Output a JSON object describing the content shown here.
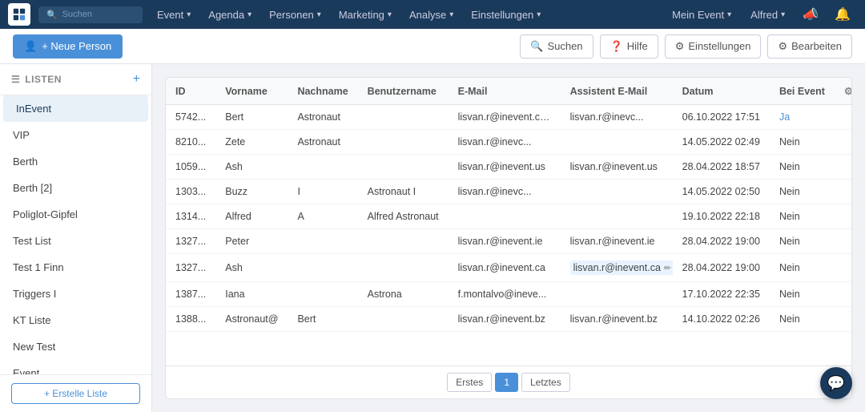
{
  "topnav": {
    "search_placeholder": "Suchen",
    "nav_items": [
      {
        "label": "Event",
        "id": "event"
      },
      {
        "label": "Agenda",
        "id": "agenda"
      },
      {
        "label": "Personen",
        "id": "personen"
      },
      {
        "label": "Marketing",
        "id": "marketing"
      },
      {
        "label": "Analyse",
        "id": "analyse"
      },
      {
        "label": "Einstellungen",
        "id": "einstellungen"
      }
    ],
    "right_items": [
      {
        "label": "Mein Event",
        "id": "mein-event"
      },
      {
        "label": "Alfred",
        "id": "alfred"
      }
    ]
  },
  "toolbar": {
    "new_person_label": "+ Neue Person",
    "search_label": "Suchen",
    "help_label": "Hilfe",
    "settings_label": "Einstellungen",
    "edit_label": "Bearbeiten"
  },
  "sidebar": {
    "title": "LISTEN",
    "items": [
      {
        "label": "InEvent",
        "id": "inevent",
        "active": true
      },
      {
        "label": "VIP",
        "id": "vip"
      },
      {
        "label": "Berth",
        "id": "berth"
      },
      {
        "label": "Berth [2]",
        "id": "berth2"
      },
      {
        "label": "Poliglot-Gipfel",
        "id": "poliglot"
      },
      {
        "label": "Test List",
        "id": "testlist"
      },
      {
        "label": "Test 1 Finn",
        "id": "test1finn"
      },
      {
        "label": "Triggers I",
        "id": "triggersi"
      },
      {
        "label": "KT Liste",
        "id": "ktliste"
      },
      {
        "label": "New Test",
        "id": "newtest"
      },
      {
        "label": "Event",
        "id": "event"
      }
    ],
    "create_label": "+ Erstelle Liste"
  },
  "table": {
    "columns": [
      "ID",
      "Vorname",
      "Nachname",
      "Benutzername",
      "E-Mail",
      "Assistent E-Mail",
      "Datum",
      "Bei Event"
    ],
    "rows": [
      {
        "id": "5742...",
        "vorname": "Bert",
        "nachname": "Astronaut",
        "benutzername": "",
        "email": "lisvan.r@inevent.com",
        "assistent_email": "lisvan.r@inevc...",
        "datum": "06.10.2022 17:51",
        "bei_event": "Ja",
        "highlight_assistent": false,
        "link_event": true
      },
      {
        "id": "8210...",
        "vorname": "Zete",
        "nachname": "Astronaut",
        "benutzername": "",
        "email": "lisvan.r@inevc...",
        "assistent_email": "",
        "datum": "14.05.2022 02:49",
        "bei_event": "Nein",
        "highlight_assistent": false,
        "link_event": false
      },
      {
        "id": "1059...",
        "vorname": "Ash",
        "nachname": "",
        "benutzername": "",
        "email": "lisvan.r@inevent.us",
        "assistent_email": "lisvan.r@inevent.us",
        "datum": "28.04.2022 18:57",
        "bei_event": "Nein",
        "highlight_assistent": false,
        "link_event": false
      },
      {
        "id": "1303...",
        "vorname": "Buzz",
        "nachname": "I",
        "benutzername": "Astronaut I",
        "email": "lisvan.r@inevc...",
        "assistent_email": "",
        "datum": "14.05.2022 02:50",
        "bei_event": "Nein",
        "highlight_assistent": false,
        "link_event": false
      },
      {
        "id": "1314...",
        "vorname": "Alfred",
        "nachname": "A",
        "benutzername": "Alfred Astronaut",
        "email": "",
        "assistent_email": "",
        "datum": "19.10.2022 22:18",
        "bei_event": "Nein",
        "highlight_assistent": false,
        "link_event": false
      },
      {
        "id": "1327...",
        "vorname": "Peter",
        "nachname": "",
        "benutzername": "",
        "email": "lisvan.r@inevent.ie",
        "assistent_email": "lisvan.r@inevent.ie",
        "datum": "28.04.2022 19:00",
        "bei_event": "Nein",
        "highlight_assistent": false,
        "link_event": false
      },
      {
        "id": "1327...",
        "vorname": "Ash",
        "nachname": "",
        "benutzername": "",
        "email": "lisvan.r@inevent.ca",
        "assistent_email": "lisvan.r@inevent.ca",
        "datum": "28.04.2022 19:00",
        "bei_event": "Nein",
        "highlight_assistent": true,
        "link_event": false
      },
      {
        "id": "1387...",
        "vorname": "Iana",
        "nachname": "",
        "benutzername": "Astrona",
        "email": "f.montalvo@ineve...",
        "assistent_email": "",
        "datum": "17.10.2022 22:35",
        "bei_event": "Nein",
        "highlight_assistent": false,
        "link_event": false
      },
      {
        "id": "1388...",
        "vorname": "Astronaut@",
        "nachname": "Bert",
        "benutzername": "",
        "email": "lisvan.r@inevent.bz",
        "assistent_email": "lisvan.r@inevent.bz",
        "datum": "14.10.2022 02:26",
        "bei_event": "Nein",
        "highlight_assistent": false,
        "link_event": false
      }
    ]
  },
  "pagination": {
    "first_label": "Erstes",
    "last_label": "Letztes",
    "current_page": "1"
  }
}
